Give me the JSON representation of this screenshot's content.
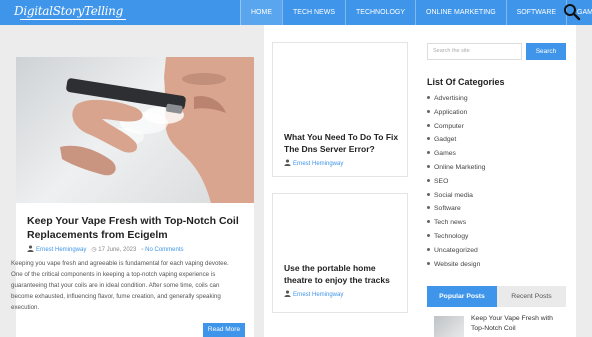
{
  "header": {
    "logo_text": "DigitalStoryTelling",
    "nav": [
      "HOME",
      "TECH NEWS",
      "TECHNOLOGY",
      "ONLINE MARKETING",
      "SOFTWARE",
      "GAMES"
    ],
    "active_index": 0,
    "search_icon": "search-icon"
  },
  "main_post": {
    "title": "Keep Your Vape Fresh with Top-Notch Coil Replacements from Ecigelm",
    "author": "Ernest Hemingway",
    "date": "17 June, 2023",
    "comments": "No Comments",
    "excerpt": "Keeping you vape fresh and agreeable is fundamental for each vaping devotee. One of the critical components in keeping a top-notch vaping experience is guaranteeing that your coils are in ideal condition. After some time, coils can become exhausted, influencing flavor, fume creation, and generally speaking execution.",
    "read_more": "Read More"
  },
  "mid_posts": [
    {
      "title": "What You Need To Do To Fix The Dns Server Error?",
      "author": "Ernest Hemingway"
    },
    {
      "title": "Use the portable home theatre to enjoy the tracks",
      "author": "Ernest Hemingway"
    }
  ],
  "sidebar": {
    "search_placeholder": "Search the site",
    "search_button": "Search",
    "categories_heading": "List Of Categories",
    "categories": [
      "Advertising",
      "Application",
      "Computer",
      "Gadget",
      "Games",
      "Online Marketing",
      "SEO",
      "Social media",
      "Software",
      "Tech news",
      "Technology",
      "Uncategorized",
      "Website design"
    ],
    "tabs": [
      "Popular Posts",
      "Recent Posts"
    ],
    "popular_post_title": "Keep Your Vape Fresh with Top-Notch Coil"
  },
  "colors": {
    "accent": "#3f95e9",
    "background": "#ececec"
  }
}
